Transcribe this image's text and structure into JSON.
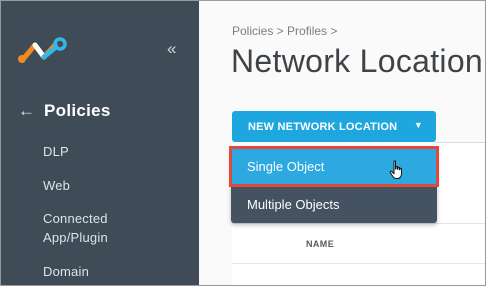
{
  "sidebar": {
    "collapse_glyph": "«",
    "back_glyph": "←",
    "section_title": "Policies",
    "items": [
      {
        "label": "DLP"
      },
      {
        "label": "Web"
      },
      {
        "label": "Connected App/Plugin"
      },
      {
        "label": "Domain"
      }
    ]
  },
  "main": {
    "breadcrumb": "Policies > Profiles >",
    "title": "Network Location",
    "new_button_label": "NEW NETWORK LOCATION",
    "new_button_caret": "▼",
    "table": {
      "column_header": "NAME"
    }
  },
  "dropdown": {
    "options": [
      {
        "label": "Single Object"
      },
      {
        "label": "Multiple Objects"
      }
    ]
  },
  "colors": {
    "sidebar_bg": "#404b58",
    "accent": "#1ea6de",
    "highlight_border": "#e0493d",
    "dropdown_bg": "#445262"
  },
  "icons": {
    "logo": "netskope-logo",
    "pointer": "hand-pointer-icon"
  }
}
